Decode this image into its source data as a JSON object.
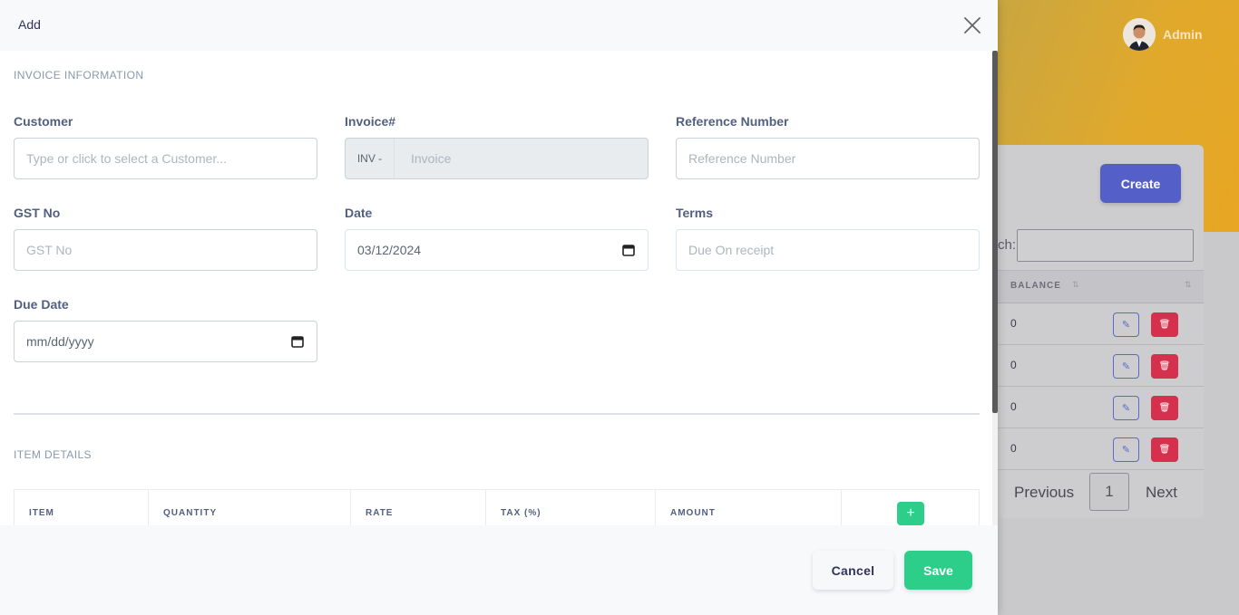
{
  "user": {
    "name": "Admin"
  },
  "background": {
    "create_label": "Create",
    "search_label": "ch:",
    "table": {
      "headers": [
        "BALANCE"
      ],
      "rows": [
        {
          "balance": "0"
        },
        {
          "balance": "0"
        },
        {
          "balance": "0"
        },
        {
          "balance": "0"
        }
      ]
    },
    "pagination": {
      "previous": "Previous",
      "page": "1",
      "next": "Next"
    }
  },
  "modal": {
    "title": "Add",
    "invoice_section": "INVOICE INFORMATION",
    "customer": {
      "label": "Customer",
      "placeholder": "Type or click to select a Customer..."
    },
    "invoice": {
      "label": "Invoice#",
      "prefix": "INV -",
      "placeholder": "Invoice"
    },
    "reference": {
      "label": "Reference Number",
      "placeholder": "Reference Number"
    },
    "gst": {
      "label": "GST No",
      "placeholder": "GST No"
    },
    "date": {
      "label": "Date",
      "value": "03/12/2024"
    },
    "terms": {
      "label": "Terms",
      "value": "Due On receipt"
    },
    "due_date": {
      "label": "Due Date",
      "placeholder": "mm/dd/yyyy"
    },
    "item_section": "ITEM DETAILS",
    "item_table_headers": [
      "ITEM",
      "QUANTITY",
      "RATE",
      "TAX (%)",
      "AMOUNT"
    ],
    "add_row_label": "+",
    "cancel_label": "Cancel",
    "save_label": "Save"
  },
  "colors": {
    "primary": "#5460c7",
    "success": "#2dce89",
    "danger": "#d6304f",
    "header_gradient_end": "#e8a623"
  }
}
